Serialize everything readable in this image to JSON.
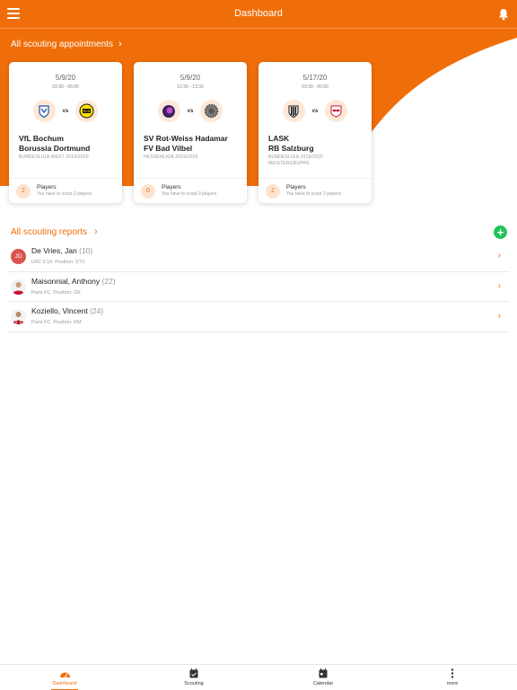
{
  "header": {
    "title": "Dashboard",
    "menu_icon": "hamburger-icon",
    "notification_icon": "bell-icon"
  },
  "colors": {
    "brand": "#f06e0a",
    "add": "#22c35e",
    "badge_bg": "#fde3cf",
    "initials_bg": "#d9534f"
  },
  "appointments": {
    "link_label": "All scouting appointments",
    "chevron": "›",
    "vs_label": "vs",
    "players_label": "Players",
    "cards": [
      {
        "date": "5/9/20",
        "time": "03:30 - 05:00",
        "home": "VfL Bochum",
        "away": "Borussia Dortmund",
        "league": "BUNDESLIGA WEST 2019/2020",
        "subleague": "",
        "count": "2",
        "players_sub": "You have to scout 2 players"
      },
      {
        "date": "5/9/20",
        "time": "12:30 - 13:30",
        "home": "SV Rot-Weiss Hadamar",
        "away": "FV Bad Vilbel",
        "league": "HESSENLIGA 2019/2020",
        "subleague": "",
        "count": "0",
        "players_sub": "You have to scout 0 players"
      },
      {
        "date": "5/17/20",
        "time": "03:30 - 05:00",
        "home": "LASK",
        "away": "RB Salzburg",
        "league": "BUNDESLIGA 2019/2020",
        "subleague": "MEISTERGRUPPE",
        "count": "2",
        "players_sub": "You have to scout 2 players"
      }
    ]
  },
  "reports": {
    "link_label": "All scouting reports",
    "chevron": "›",
    "add_label": "+",
    "items": [
      {
        "name": "De Vries, Jan",
        "number": "(10)",
        "initials": "JD",
        "club": "LRC 0.10",
        "position": "Position: STC"
      },
      {
        "name": "Maisonnial, Anthony",
        "number": "(22)",
        "initials": "",
        "club": "Paris FC",
        "position": "Position: GK"
      },
      {
        "name": "Koziello, Vincent",
        "number": "(24)",
        "initials": "",
        "club": "Paris FC",
        "position": "Position: RM"
      }
    ]
  },
  "nav": {
    "items": [
      {
        "label": "Dashboard",
        "icon": "speedometer-icon"
      },
      {
        "label": "Scouting",
        "icon": "calendar-check-icon"
      },
      {
        "label": "Calendar",
        "icon": "calendar-icon"
      },
      {
        "label": "more",
        "icon": "more-vertical-icon"
      }
    ]
  }
}
